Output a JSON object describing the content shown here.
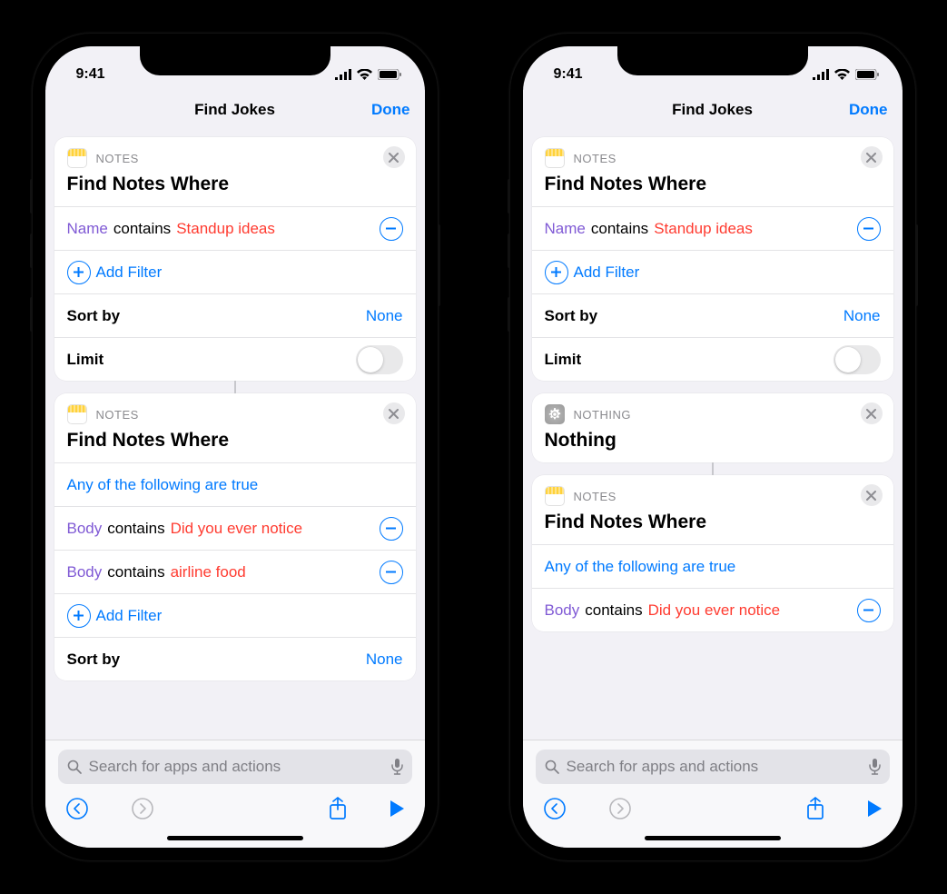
{
  "phones": [
    {
      "status": {
        "time": "9:41"
      },
      "nav": {
        "title": "Find Jokes",
        "done": "Done"
      },
      "search_placeholder": "Search for apps and actions",
      "cards": [
        {
          "kind": "notes",
          "app_label": "NOTES",
          "title": "Find Notes Where",
          "group_label": null,
          "filters": [
            {
              "field": "Name",
              "op": "contains",
              "value": "Standup ideas"
            }
          ],
          "add_filter": "Add Filter",
          "sort": {
            "label": "Sort by",
            "value": "None"
          },
          "limit": {
            "label": "Limit",
            "on": false
          },
          "connect_after": true
        },
        {
          "kind": "notes",
          "app_label": "NOTES",
          "title": "Find Notes Where",
          "group_label": "Any of the following are true",
          "filters": [
            {
              "field": "Body",
              "op": "contains",
              "value": "Did you ever notice"
            },
            {
              "field": "Body",
              "op": "contains",
              "value": "airline food"
            }
          ],
          "add_filter": "Add Filter",
          "sort": {
            "label": "Sort by",
            "value": "None"
          },
          "limit": null,
          "connect_after": false
        }
      ]
    },
    {
      "status": {
        "time": "9:41"
      },
      "nav": {
        "title": "Find Jokes",
        "done": "Done"
      },
      "search_placeholder": "Search for apps and actions",
      "cards": [
        {
          "kind": "notes",
          "app_label": "NOTES",
          "title": "Find Notes Where",
          "group_label": null,
          "filters": [
            {
              "field": "Name",
              "op": "contains",
              "value": "Standup ideas"
            }
          ],
          "add_filter": "Add Filter",
          "sort": {
            "label": "Sort by",
            "value": "None"
          },
          "limit": {
            "label": "Limit",
            "on": false
          },
          "connect_after": false
        },
        {
          "kind": "nothing",
          "app_label": "NOTHING",
          "title": "Nothing",
          "connect_after": true
        },
        {
          "kind": "notes",
          "app_label": "NOTES",
          "title": "Find Notes Where",
          "group_label": "Any of the following are true",
          "filters": [
            {
              "field": "Body",
              "op": "contains",
              "value": "Did you ever notice"
            }
          ],
          "add_filter": null,
          "sort": null,
          "limit": null,
          "connect_after": false
        }
      ]
    }
  ]
}
